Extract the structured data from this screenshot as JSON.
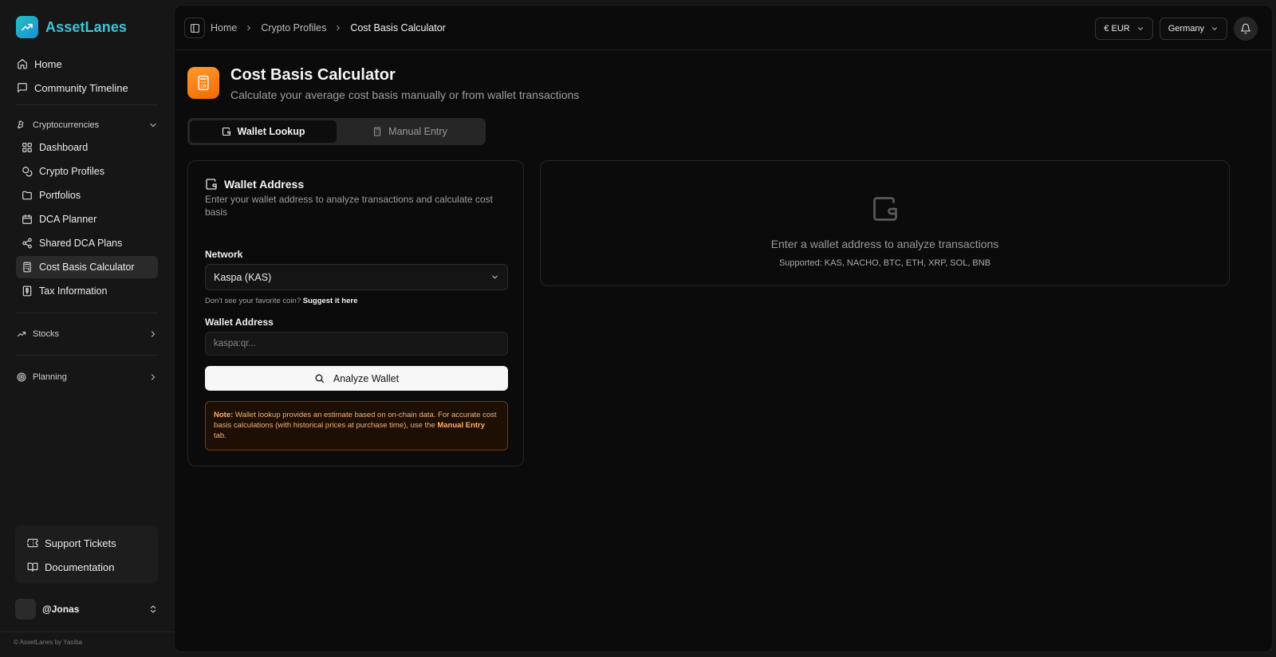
{
  "app": {
    "name": "AssetLanes",
    "accent": "#3ec6d8"
  },
  "sidebar": {
    "top_items": [
      {
        "label": "Home",
        "icon": "home-icon"
      },
      {
        "label": "Community Timeline",
        "icon": "message-square-icon"
      }
    ],
    "crypto_section": {
      "label": "Cryptocurrencies",
      "icon": "bitcoin-icon",
      "expanded": true
    },
    "crypto_items": [
      {
        "label": "Dashboard",
        "icon": "grid-icon"
      },
      {
        "label": "Crypto Profiles",
        "icon": "coins-icon"
      },
      {
        "label": "Portfolios",
        "icon": "folder-icon"
      },
      {
        "label": "DCA Planner",
        "icon": "calendar-icon"
      },
      {
        "label": "Shared DCA Plans",
        "icon": "share-icon"
      },
      {
        "label": "Cost Basis Calculator",
        "icon": "calculator-icon",
        "active": true
      },
      {
        "label": "Tax Information",
        "icon": "receipt-icon"
      }
    ],
    "stocks_section": {
      "label": "Stocks",
      "icon": "trending-up-icon"
    },
    "planning_section": {
      "label": "Planning",
      "icon": "target-icon"
    },
    "bottom_items": [
      {
        "label": "Support Tickets",
        "icon": "ticket-icon"
      },
      {
        "label": "Documentation",
        "icon": "book-icon"
      }
    ],
    "user": {
      "name": "@Jonas"
    },
    "footer": "© AssetLanes by Yasiba"
  },
  "topbar": {
    "breadcrumbs": [
      "Home",
      "Crypto Profiles",
      "Cost Basis Calculator"
    ],
    "currency": "€ EUR",
    "country": "Germany"
  },
  "page": {
    "title": "Cost Basis Calculator",
    "subtitle": "Calculate your average cost basis manually or from wallet transactions",
    "accent": "#f27a10",
    "tabs": [
      {
        "label": "Wallet Lookup",
        "active": true
      },
      {
        "label": "Manual Entry",
        "active": false
      }
    ]
  },
  "wallet_card": {
    "title": "Wallet Address",
    "description": "Enter your wallet address to analyze transactions and calculate cost basis",
    "network_label": "Network",
    "network_value": "Kaspa (KAS)",
    "hint_prefix": "Don't see your favorite coin?",
    "hint_link": "Suggest it here",
    "address_label": "Wallet Address",
    "address_placeholder": "kaspa:qr...",
    "address_value": "",
    "analyze_button": "Analyze Wallet",
    "note_label": "Note:",
    "note_text": "Wallet lookup provides an estimate based on on-chain data. For accurate cost basis calculations (with historical prices at purchase time), use the",
    "note_link": "Manual Entry",
    "note_suffix": "tab."
  },
  "results_card": {
    "title": "Enter a wallet address to analyze transactions",
    "supported": "Supported: KAS, NACHO, BTC, ETH, XRP, SOL, BNB"
  }
}
